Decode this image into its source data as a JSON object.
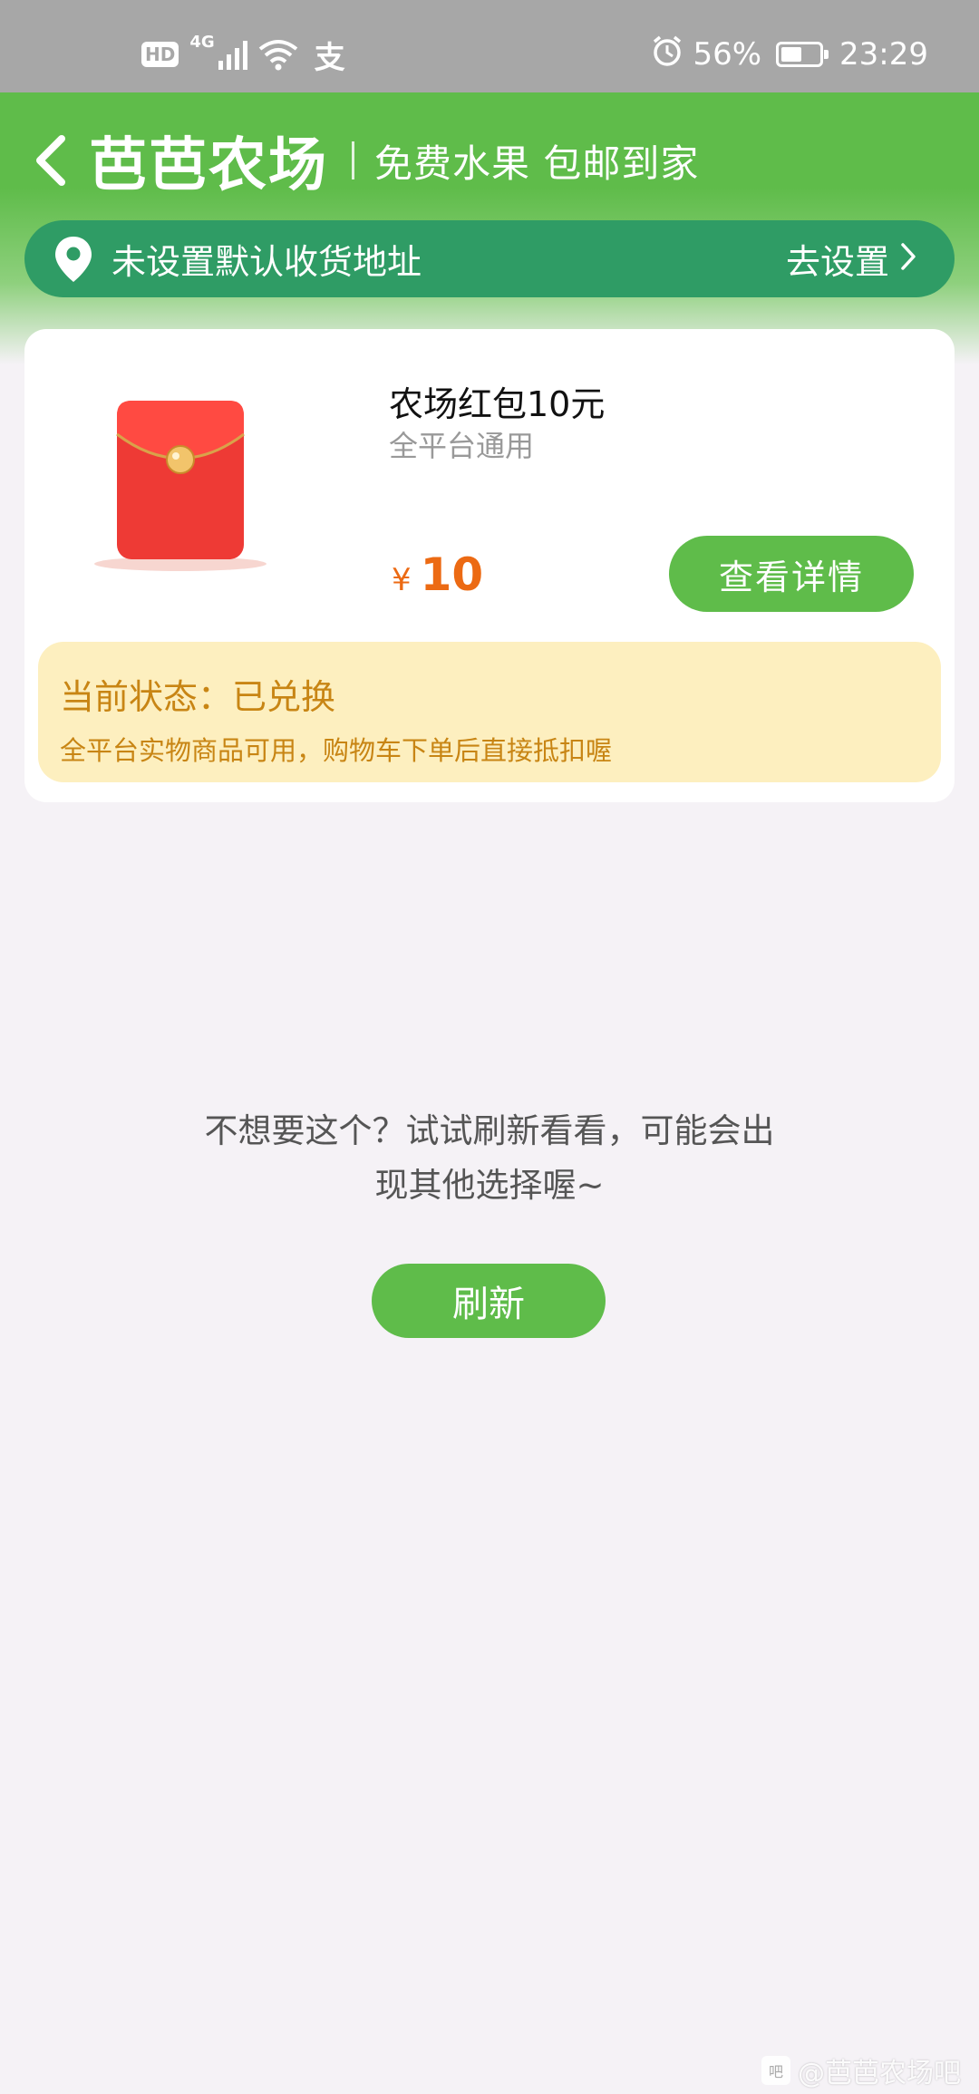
{
  "status_bar": {
    "hd": "HD",
    "network": "4G",
    "alipay_glyph": "支",
    "battery_percent": "56%",
    "battery_level": 0.56,
    "time": "23:29"
  },
  "header": {
    "brand": "芭芭农场",
    "slogan": "免费水果 包邮到家",
    "address": {
      "text": "未设置默认收货地址",
      "action": "去设置"
    }
  },
  "product": {
    "name": "农场红包10元",
    "scope": "全平台通用",
    "currency": "¥",
    "amount": "10",
    "detail_button": "查看详情",
    "status_title": "当前状态：已兑换",
    "status_desc": "全平台实物商品可用，购物车下单后直接抵扣喔"
  },
  "refresh": {
    "hint_line1": "不想要这个？试试刷新看看，可能会出",
    "hint_line2": "现其他选择喔~",
    "button": "刷新"
  },
  "watermark": {
    "logo_text": "吧",
    "text": "@芭芭农场吧"
  },
  "colors": {
    "brand_green": "#5fbc4a",
    "address_green": "#2f9c65",
    "price_orange": "#ec6a13",
    "status_bg": "#fdefbf",
    "status_text": "#c88514",
    "page_bg": "#f5f2f6"
  },
  "icons": [
    "signal-icon",
    "wifi-icon",
    "alarm-icon",
    "battery-icon",
    "back-icon",
    "location-pin-icon",
    "chevron-right-icon",
    "red-packet-icon"
  ]
}
